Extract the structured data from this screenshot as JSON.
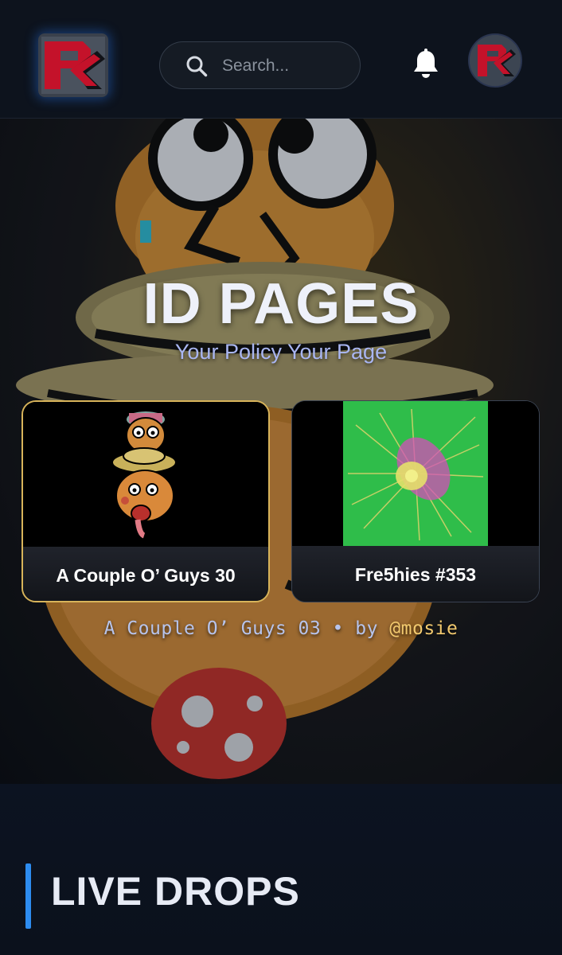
{
  "header": {
    "logo_icon": "rr-brand-logo-icon",
    "search": {
      "placeholder": "Search...",
      "value": ""
    },
    "notifications_icon": "bell-icon",
    "avatar_icon": "user-avatar-logo"
  },
  "hero": {
    "title": "ID PAGES",
    "subtitle": "Your Policy Your Page",
    "cards": [
      {
        "label": "A Couple O’ Guys 30",
        "selected": true
      },
      {
        "label": "Fre5hies #353",
        "selected": false
      }
    ],
    "caption": {
      "text": "A Couple O’ Guys 03 • by ",
      "handle": "@mosie"
    }
  },
  "section": {
    "title": "LIVE DROPS"
  },
  "colors": {
    "accent": "#2d8cf0",
    "selected_border": "#d8b45a",
    "handle": "#f2c96e",
    "subtitle": "#a9b6f2"
  }
}
